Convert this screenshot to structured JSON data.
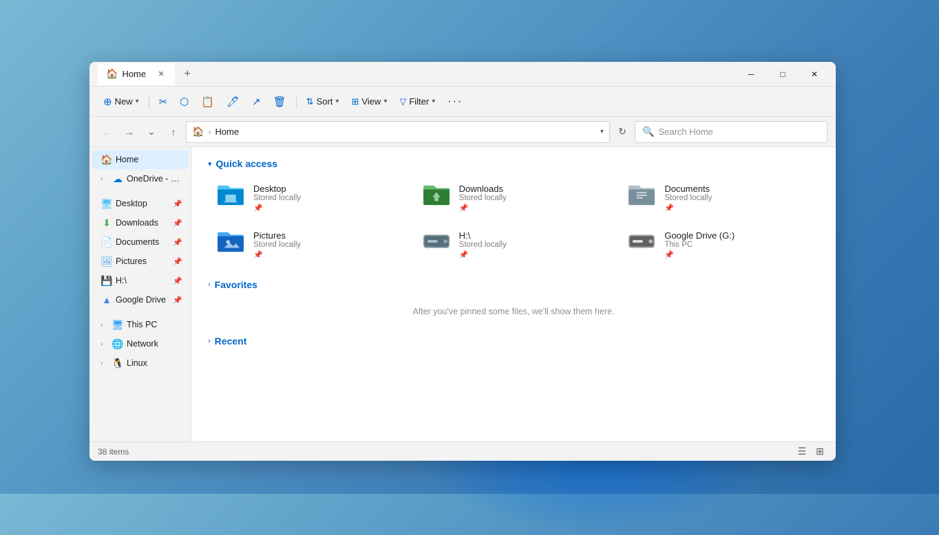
{
  "window": {
    "title": "Home",
    "tab_label": "Home",
    "new_tab_tooltip": "New tab"
  },
  "window_controls": {
    "minimize": "─",
    "maximize": "□",
    "close": "✕"
  },
  "toolbar": {
    "new_label": "New",
    "cut_tooltip": "Cut",
    "copy_tooltip": "Copy",
    "paste_tooltip": "Paste",
    "rename_tooltip": "Rename",
    "share_tooltip": "Share",
    "delete_tooltip": "Delete",
    "sort_label": "Sort",
    "view_label": "View",
    "filter_label": "Filter",
    "more_tooltip": "More"
  },
  "address_bar": {
    "location": "Home",
    "search_placeholder": "Search Home"
  },
  "sidebar": {
    "home_label": "Home",
    "onedrive_label": "OneDrive - Pers",
    "items": [
      {
        "id": "desktop",
        "label": "Desktop",
        "has_pin": true
      },
      {
        "id": "downloads",
        "label": "Downloads",
        "has_pin": true
      },
      {
        "id": "documents",
        "label": "Documents",
        "has_pin": true
      },
      {
        "id": "pictures",
        "label": "Pictures",
        "has_pin": true
      },
      {
        "id": "h",
        "label": "H:\\",
        "has_pin": true
      },
      {
        "id": "googledrive",
        "label": "Google Drive",
        "has_pin": true
      }
    ],
    "this_pc_label": "This PC",
    "network_label": "Network",
    "linux_label": "Linux"
  },
  "content": {
    "quick_access_header": "Quick access",
    "favorites_header": "Favorites",
    "recent_header": "Recent",
    "favorites_empty": "After you've pinned some files, we'll show them here.",
    "folders": [
      {
        "id": "desktop",
        "name": "Desktop",
        "sub": "Stored locally"
      },
      {
        "id": "downloads",
        "name": "Downloads",
        "sub": "Stored locally"
      },
      {
        "id": "documents",
        "name": "Documents",
        "sub": "Stored locally"
      },
      {
        "id": "pictures",
        "name": "Pictures",
        "sub": "Stored locally"
      },
      {
        "id": "h",
        "name": "H:\\",
        "sub": "Stored locally"
      },
      {
        "id": "googledrive",
        "name": "Google Drive (G:)",
        "sub": "This PC"
      }
    ]
  },
  "status_bar": {
    "items_count": "38",
    "items_label": "items"
  }
}
